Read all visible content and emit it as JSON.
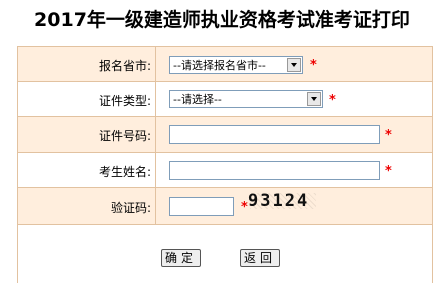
{
  "title": "2017年一级建造师执业资格考试准考证打印",
  "form": {
    "province_label": "报名省市:",
    "province_value": "--请选择报名省市--",
    "id_type_label": "证件类型:",
    "id_type_value": "--请选择--",
    "id_number_label": "证件号码:",
    "name_label": "考生姓名:",
    "captcha_label": "验证码:",
    "captcha_text": "93124",
    "required_mark": "*"
  },
  "buttons": {
    "confirm": "确定",
    "back": "返回"
  }
}
